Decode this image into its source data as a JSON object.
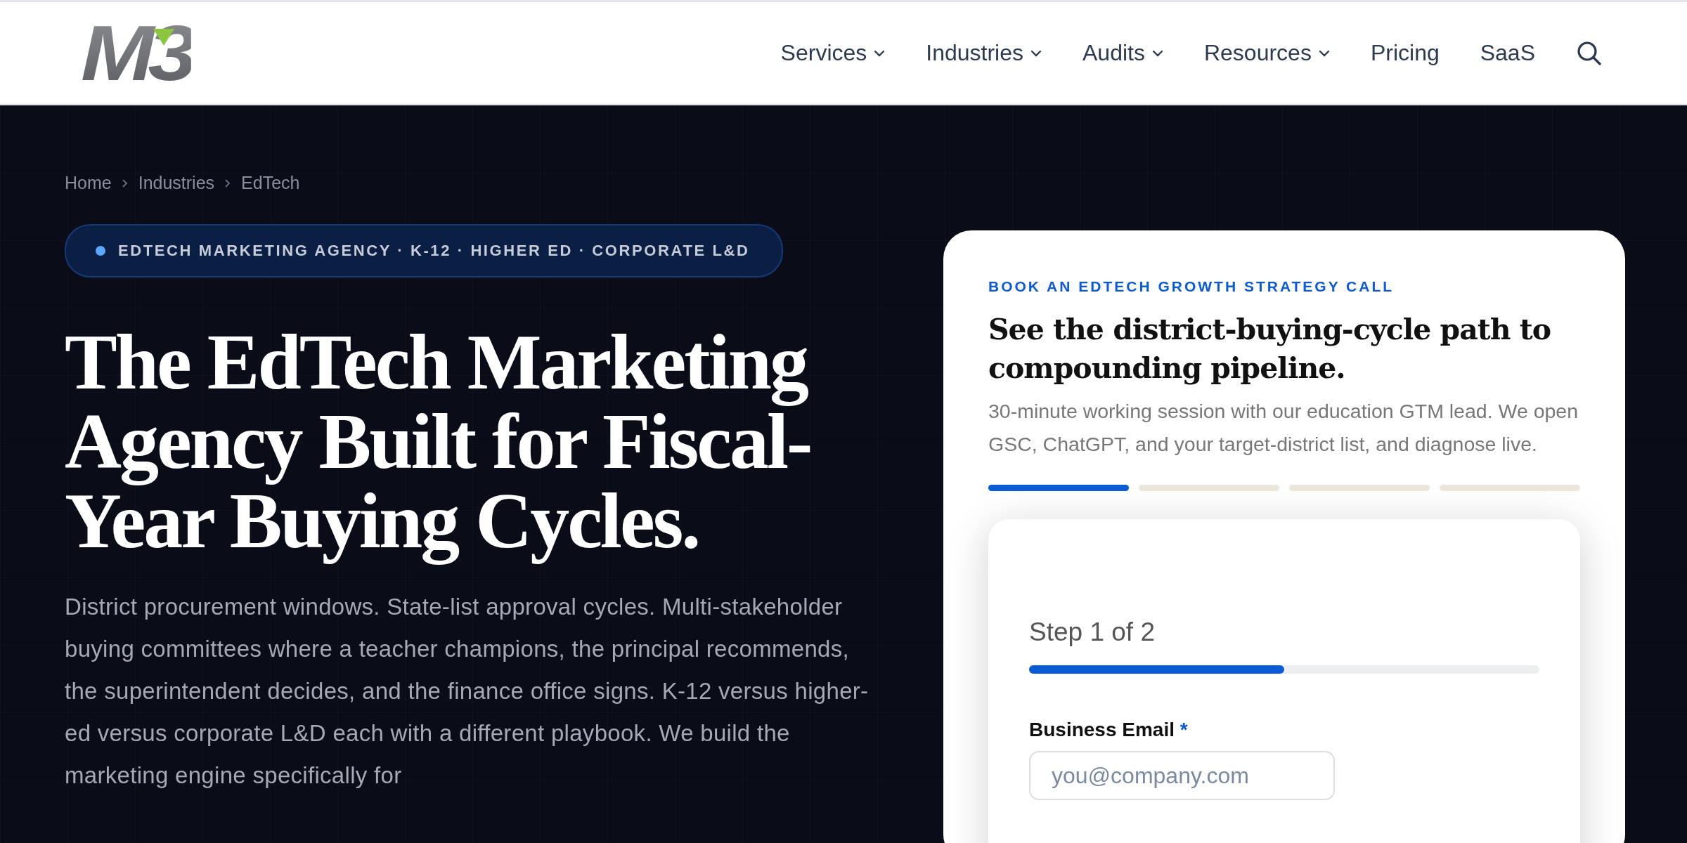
{
  "header": {
    "logo": "M3",
    "nav": [
      {
        "label": "Services",
        "dropdown": true
      },
      {
        "label": "Industries",
        "dropdown": true
      },
      {
        "label": "Audits",
        "dropdown": true
      },
      {
        "label": "Resources",
        "dropdown": true
      },
      {
        "label": "Pricing",
        "dropdown": false
      },
      {
        "label": "SaaS",
        "dropdown": false
      }
    ]
  },
  "breadcrumb": [
    "Home",
    "Industries",
    "EdTech"
  ],
  "hero": {
    "tag": "EDTECH MARKETING AGENCY · K-12 · HIGHER ED · CORPORATE L&D",
    "title": "The EdTech Marketing Agency Built for Fiscal-Year Buying Cycles.",
    "text": "District procurement windows. State-list approval cycles. Multi-stakeholder buying committees where a teacher champions, the principal recommends, the superintendent decides, and the finance office signs. K-12 versus higher-ed versus corporate L&D each with a different playbook. We build the marketing engine specifically for"
  },
  "booking": {
    "eyebrow": "BOOK AN EDTECH GROWTH STRATEGY CALL",
    "title": "See the district-buying-cycle path to compounding pipeline.",
    "text": "30-minute working session with our education GTM lead. We open GSC, ChatGPT, and your target-district list, and diagnose live.",
    "segments": [
      {
        "filled": true
      },
      {
        "filled": false
      },
      {
        "filled": false
      },
      {
        "filled": false
      }
    ],
    "form": {
      "step": "Step 1 of 2",
      "level": 0.5,
      "fields": [
        {
          "label": "Business Email",
          "required": true,
          "required_mark": "*",
          "placeholder": "you@company.com"
        }
      ]
    }
  }
}
